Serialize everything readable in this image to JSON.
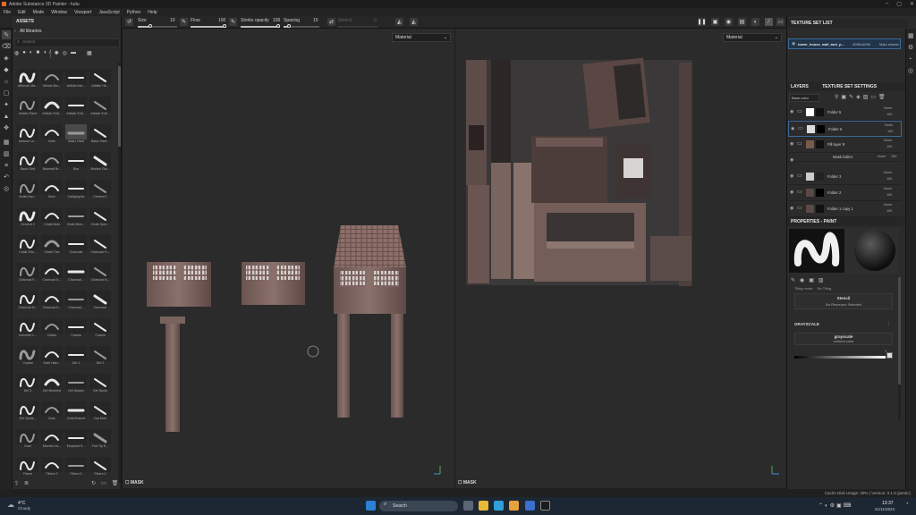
{
  "window": {
    "title": "Adobe Substance 3D Painter - hutu"
  },
  "menu": [
    "File",
    "Edit",
    "Mode",
    "Window",
    "Viewport",
    "JavaScript",
    "Python",
    "Help"
  ],
  "toolbar": {
    "size_label": "Size",
    "size_value": "10",
    "flow_label": "Flow",
    "flow_value": "100",
    "stroke_opacity_label": "Stroke opacity",
    "stroke_opacity_value": "100",
    "spacing_label": "Spacing",
    "spacing_value": "15",
    "jitter_label": "Stencil",
    "jitter_value": "0"
  },
  "assets": {
    "title": "ASSETS",
    "library": "All libraries",
    "search_placeholder": "Search",
    "brushes": [
      "Airbrush Ma...",
      "Artistic Bru...",
      "Artistic Inte...",
      "Artistic He...",
      "Artistic Paint",
      "Artistic Soft...",
      "Artistic Soft...",
      "Artistic Soft...",
      "Autumn Le...",
      "Bark",
      "Basic Hard",
      "Basic Hard...",
      "Basic Soft",
      "Basmati Br...",
      "Blur",
      "Broken Gla...",
      "Bullet Imp...",
      "Burn",
      "Calligraphic",
      "Cement 1",
      "Cement 2",
      "Chalk Bold",
      "Chalk Bum...",
      "Chalk Spre...",
      "Chalk Stro...",
      "Chalk Thin",
      "Charcoal",
      "Charcoal Fi...",
      "Charcoal F...",
      "Charcoal G...",
      "Charcoal...",
      "Charcoal N...",
      "Charcoal N...",
      "Charcoal S...",
      "Charcoal...",
      "Concrete",
      "Concrete L...",
      "Cotton",
      "Cracks",
      "Cracks",
      "Crystal",
      "Dark Halo...",
      "Dirt 1",
      "Dirt 2",
      "Dirt 3",
      "Dirt Brushed",
      "Dirt Splash",
      "Dirt Spots",
      "Dirt Spots...",
      "Dots",
      "Dots Erased",
      "Dry Mud",
      "Dust",
      "Electric Lin...",
      "Elephant S...",
      "Felt Tip S...",
      "Fibers",
      "Fibers 2",
      "Fibers 3",
      "Fibers 4"
    ]
  },
  "viewport": {
    "left_mode": "Material",
    "right_mode": "Material",
    "mask_label": "MASK"
  },
  "texture_set_list": {
    "title": "TEXTURE SET LIST",
    "item_name": "tower_house_wall_and_p...",
    "item_res": "4096x4096",
    "item_shader": "Main shader"
  },
  "layers_panel": {
    "tab_layers": "LAYERS",
    "tab_settings": "TEXTURE SET SETTINGS",
    "channel": "Base color",
    "layers": [
      {
        "name": "Folder 5",
        "blend": "Norm",
        "opacity": "100"
      },
      {
        "name": "Folder 6",
        "blend": "Norm",
        "opacity": "100"
      },
      {
        "name": "Fill layer 8",
        "blend": "Norm",
        "opacity": "100"
      },
      {
        "name": "Mask Editor",
        "blend": "Norm",
        "opacity": "100"
      },
      {
        "name": "Folder 3",
        "blend": "Norm",
        "opacity": "100"
      },
      {
        "name": "Folder 2",
        "blend": "Norm",
        "opacity": "100"
      },
      {
        "name": "Folder 1 copy 1",
        "blend": "Norm",
        "opacity": "100"
      }
    ]
  },
  "properties": {
    "title": "PROPERTIES - PAINT",
    "tiling_label": "Tiling mode",
    "tiling_value": "No Tiling",
    "stencil_label": "Stencil",
    "stencil_value": "No Resource Selected",
    "grayscale_title": "GRAYSCALE",
    "grayscale_name": "grayscale",
    "grayscale_sub": "uniform color",
    "grayscale_value": "1"
  },
  "status": {
    "text": "Cache Disk Usage:   29%  |  Version: 9.1.0 (pentic)"
  },
  "taskbar": {
    "weather_temp": "4°C",
    "weather_desc": "Cloudy",
    "search_label": "Search",
    "time": "13:37",
    "date": "21/11/2024"
  },
  "colors": {
    "accent": "#4a90d9",
    "panel": "#2b2b2b",
    "viewport": "#2b2b2b"
  }
}
